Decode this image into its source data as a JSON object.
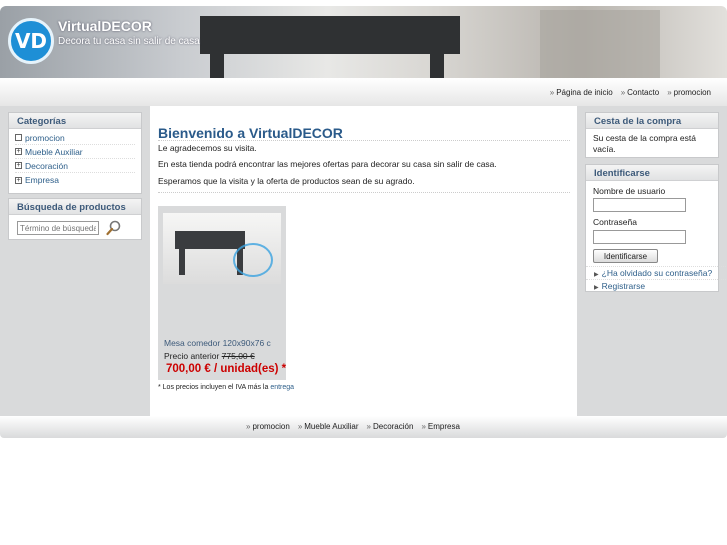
{
  "header": {
    "logo_text": "VD",
    "title": "VirtualDECOR",
    "slogan": "Decora tu casa sin salir de casa"
  },
  "topnav": {
    "items": [
      "Página de inicio",
      "Contacto",
      "promocion"
    ]
  },
  "categories": {
    "title": "Categorías",
    "items": [
      {
        "label": "promocion",
        "icon": "empty-box-icon"
      },
      {
        "label": "Mueble Auxiliar",
        "icon": "plus-box-icon"
      },
      {
        "label": "Decoración",
        "icon": "plus-box-icon"
      },
      {
        "label": "Empresa",
        "icon": "plus-box-icon"
      }
    ]
  },
  "search": {
    "title": "Búsqueda de productos",
    "placeholder": "Término de búsqueda"
  },
  "main": {
    "title": "Bienvenido a VirtualDECOR",
    "p1": "Le agradecemos su visita.",
    "p2": "En esta tienda podrá encontrar las mejores ofertas para decorar su casa sin salir de casa.",
    "p3": "Esperamos que la visita y la oferta de productos sean de su agrado.",
    "product": {
      "name": "Mesa comedor 120x90x76 c",
      "old_price_label": "Precio anterior",
      "old_price": "775,00 €",
      "price": "700,00 € / unidad(es) *"
    },
    "note": "* Los precios incluyen el IVA más la",
    "note_link": "entrega"
  },
  "cart": {
    "title": "Cesta de la compra",
    "text": "Su cesta de la compra está vacía."
  },
  "login": {
    "title": "Identificarse",
    "username_label": "Nombre de usuario",
    "password_label": "Contraseña",
    "button": "Identificarse",
    "forgot": "¿Ha olvidado su contraseña?",
    "register": "Registrarse"
  },
  "footer": {
    "items": [
      "promocion",
      "Mueble Auxiliar",
      "Decoración",
      "Empresa"
    ]
  },
  "colors": {
    "link": "#2e5f8a",
    "heading": "#2a5a8a",
    "price": "#cc0000",
    "sidebar_bg": "#d9dadb",
    "logo": "#1e8fd6"
  }
}
